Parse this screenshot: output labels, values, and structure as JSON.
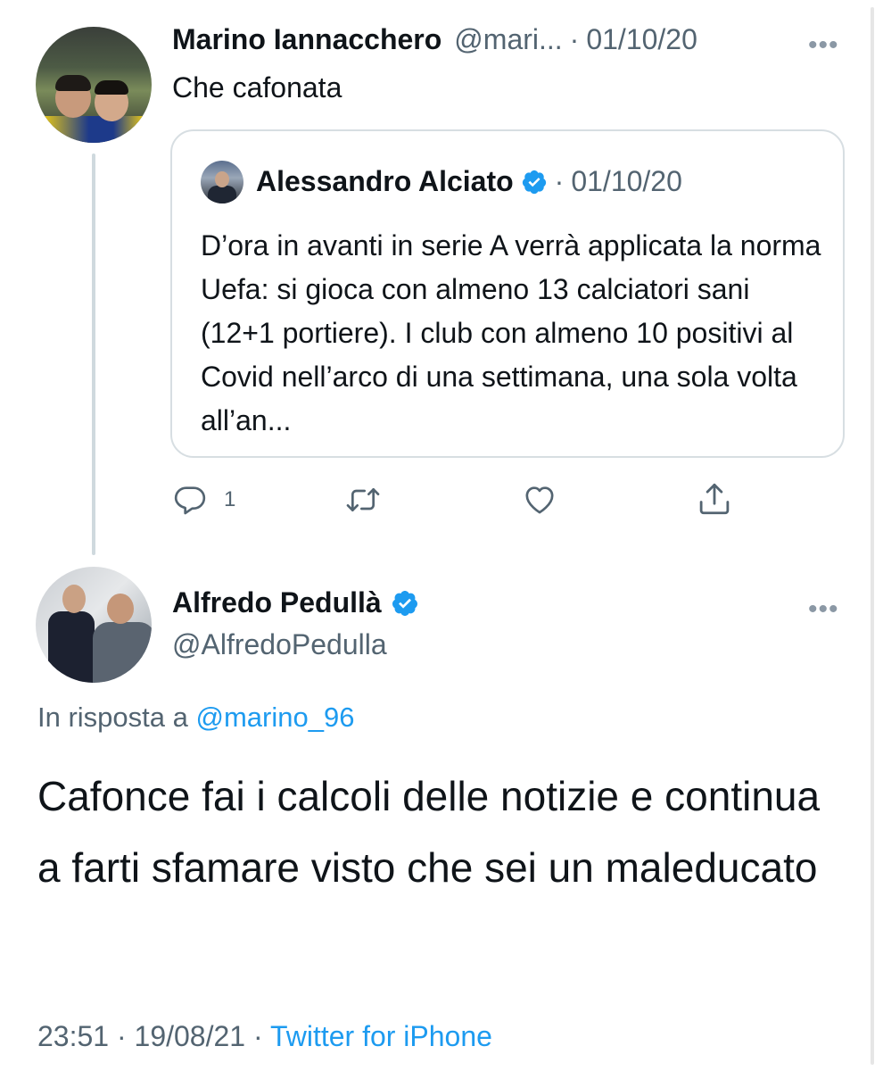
{
  "parent_tweet": {
    "author_name": "Marino Iannacchero",
    "author_handle": "@mari...",
    "separator": "·",
    "date": "01/10/20",
    "text": "Che cafonata",
    "more_icon": "ellipsis-icon",
    "quoted_tweet": {
      "author_name": "Alessandro Alciato",
      "verified": true,
      "separator": "·",
      "date": "01/10/20",
      "text": "D’ora in avanti in serie A verrà applicata la norma Uefa: si gioca con almeno 13 calciatori sani (12+1 portiere). I club con almeno 10 positivi al Covid nell’arco di una settimana, una sola volta all’an..."
    },
    "actions": {
      "reply_count": "1",
      "icons": [
        "reply-icon",
        "retweet-icon",
        "like-icon",
        "share-icon"
      ]
    }
  },
  "reply_tweet": {
    "author_name": "Alfredo Pedullà",
    "verified": true,
    "author_handle": "@AlfredoPedulla",
    "in_reply_prefix": "In risposta a",
    "in_reply_handle": "@marino_96",
    "text": "Cafonce fai i calcoli delle notizie e continua a farti sfamare visto che sei un maleducato",
    "time": "23:51",
    "date": "19/08/21",
    "separator": "·",
    "source": "Twitter for iPhone"
  },
  "colors": {
    "link": "#1d9bf0",
    "muted": "#536471",
    "text": "#0f1419",
    "border": "#d7dee2",
    "thread_line": "#cfd9de"
  }
}
